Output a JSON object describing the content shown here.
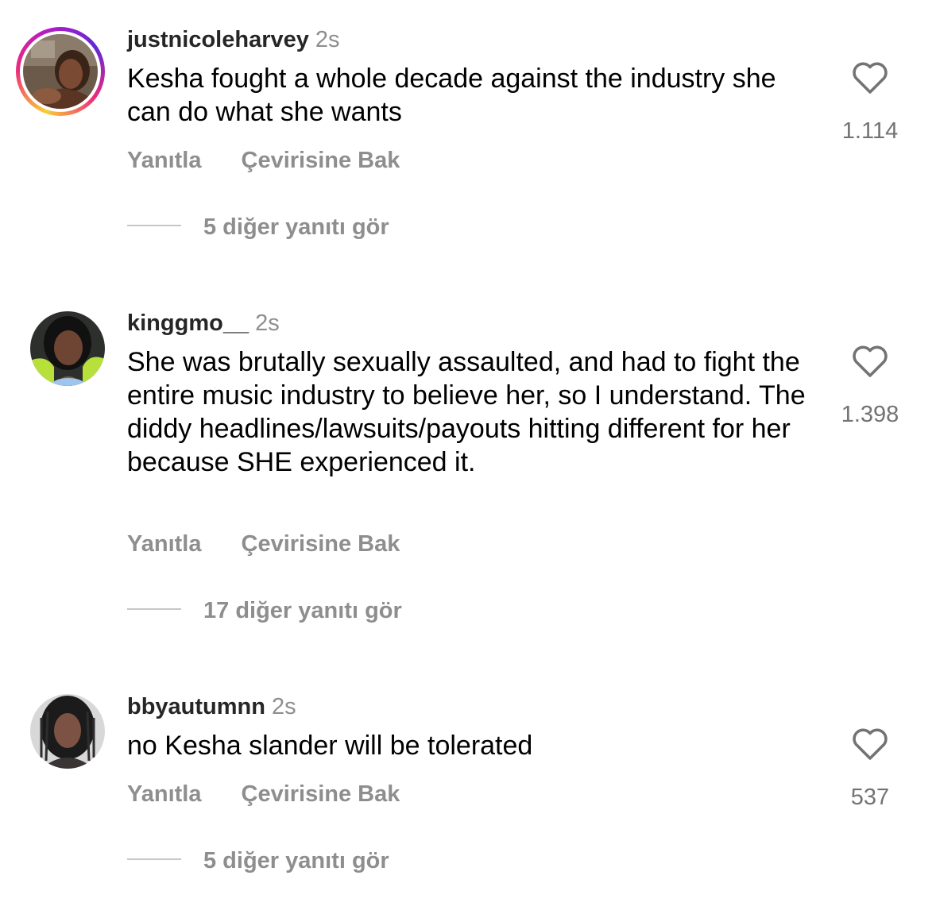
{
  "comments": [
    {
      "username": "justnicoleharvey",
      "time": "2s",
      "text": "Kesha fought a whole decade against the industry she can do what she wants",
      "reply_label": "Yanıtla",
      "translate_label": "Çevirisine Bak",
      "likes": "1.114",
      "view_replies": "5 diğer yanıtı gör",
      "has_story_ring": true
    },
    {
      "username": "kinggmo__",
      "time": "2s",
      "text": "She was brutally sexually assaulted, and had to fight the entire music industry to believe her, so I understand. The diddy headlines/lawsuits/payouts hitting different for her because SHE experienced it.",
      "reply_label": "Yanıtla",
      "translate_label": "Çevirisine Bak",
      "likes": "1.398",
      "view_replies": "17 diğer yanıtı gör",
      "has_story_ring": false
    },
    {
      "username": "bbyautumnn",
      "time": "2s",
      "text": "no Kesha slander will be tolerated",
      "reply_label": "Yanıtla",
      "translate_label": "Çevirisine Bak",
      "likes": "537",
      "view_replies": "5 diğer yanıtı gör",
      "has_story_ring": false
    }
  ],
  "icons": {
    "like": "heart-outline-icon"
  },
  "colors": {
    "username": "#262626",
    "secondary_text": "#8e8e8e",
    "like_count": "#737373"
  }
}
